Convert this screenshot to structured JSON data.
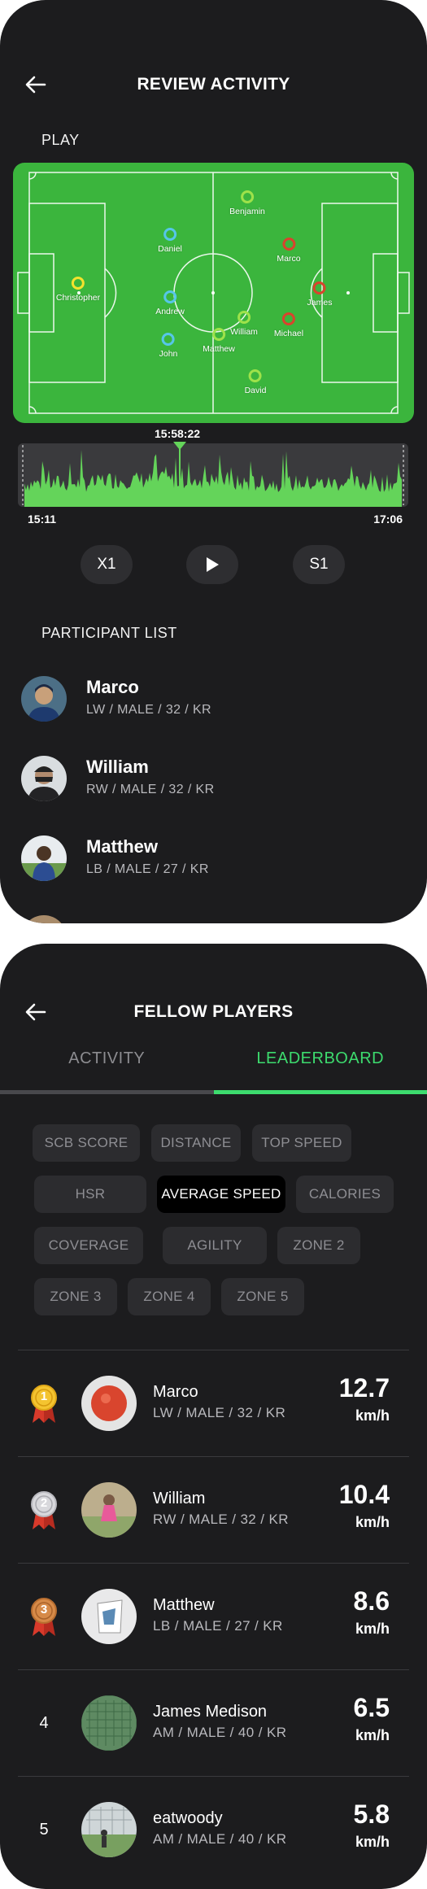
{
  "review": {
    "title": "REVIEW ACTIVITY",
    "play_label": "PLAY",
    "players": [
      {
        "name": "Benjamin",
        "color": "#9ee24a"
      },
      {
        "name": "Daniel",
        "color": "#56c6e8"
      },
      {
        "name": "Marco",
        "color": "#d9432d"
      },
      {
        "name": "Christopher",
        "color": "#f3e22d"
      },
      {
        "name": "Andrew",
        "color": "#56c6e8"
      },
      {
        "name": "James",
        "color": "#d9432d"
      },
      {
        "name": "William",
        "color": "#9ee24a"
      },
      {
        "name": "Michael",
        "color": "#d9432d"
      },
      {
        "name": "Matthew",
        "color": "#9ee24a"
      },
      {
        "name": "John",
        "color": "#56c6e8"
      },
      {
        "name": "David",
        "color": "#9ee24a"
      }
    ],
    "timeline": {
      "cursor_time": "15:58:22",
      "start_time": "15:11",
      "end_time": "17:06",
      "color": "#64d45a"
    },
    "controls": {
      "speed": "X1",
      "play_icon": "play-icon",
      "segment": "S1"
    },
    "participant_label": "PARTICIPANT LIST",
    "participants": [
      {
        "name": "Marco",
        "meta": "LW / MALE / 32 / KR"
      },
      {
        "name": "William",
        "meta": "RW / MALE / 32 / KR"
      },
      {
        "name": "Matthew",
        "meta": "LB / MALE / 27 / KR"
      }
    ]
  },
  "fellow": {
    "title": "FELLOW PLAYERS",
    "tabs": [
      {
        "label": "ACTIVITY",
        "active": false
      },
      {
        "label": "LEADERBOARD",
        "active": true
      }
    ],
    "accent": "#3ddb6e",
    "chips": [
      "SCB SCORE",
      "DISTANCE",
      "TOP SPEED",
      "HSR",
      "AVERAGE SPEED",
      "CALORIES",
      "COVERAGE",
      "AGILITY",
      "ZONE 2",
      "ZONE 3",
      "ZONE 4",
      "ZONE 5"
    ],
    "selected_chip": "AVERAGE SPEED",
    "leaderboard": [
      {
        "rank": "1",
        "medal": "gold",
        "name": "Marco",
        "meta": "LW / MALE / 32 / KR",
        "value": "12.7",
        "unit": "km/h"
      },
      {
        "rank": "2",
        "medal": "silver",
        "name": "William",
        "meta": "RW / MALE / 32 / KR",
        "value": "10.4",
        "unit": "km/h"
      },
      {
        "rank": "3",
        "medal": "bronze",
        "name": "Matthew",
        "meta": "LB / MALE / 27 / KR",
        "value": "8.6",
        "unit": "km/h"
      },
      {
        "rank": "4",
        "medal": "",
        "name": "James Medison",
        "meta": "AM / MALE / 40 / KR",
        "value": "6.5",
        "unit": "km/h"
      },
      {
        "rank": "5",
        "medal": "",
        "name": "eatwoody",
        "meta": "AM / MALE / 40 / KR",
        "value": "5.8",
        "unit": "km/h"
      }
    ]
  }
}
